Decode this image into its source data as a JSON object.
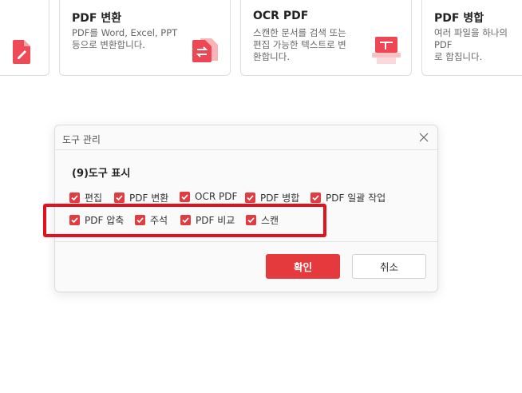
{
  "cards": [
    {
      "title": "",
      "desc_line1": "",
      "desc_line2": "",
      "icon": "edit-file-icon"
    },
    {
      "title": "PDF 변환",
      "desc_line1": "PDF를 Word, Excel, PPT",
      "desc_line2": "등으로 변환합니다.",
      "icon": "convert-file-icon"
    },
    {
      "title": "OCR PDF",
      "desc_line1": "스캔한 문서를 검색 또는",
      "desc_line2": "편집 가능한 텍스트로 변",
      "desc_line3": "환합니다.",
      "icon": "scanner-icon"
    },
    {
      "title": "PDF 병합",
      "desc_line1": "여러 파일을 하나의 PDF",
      "desc_line2": "로 합칩니다.",
      "icon": "merge-icon"
    }
  ],
  "dialog": {
    "title": "도구 관리",
    "section_title": "(9)도구 표시",
    "row1": [
      {
        "label": "편집",
        "checked": true
      },
      {
        "label": "PDF 변환",
        "checked": true
      },
      {
        "label": "OCR PDF",
        "checked": true
      },
      {
        "label": "PDF 병합",
        "checked": true
      },
      {
        "label": "PDF 일괄 작업",
        "checked": true
      }
    ],
    "row2": [
      {
        "label": "PDF 압축",
        "checked": true
      },
      {
        "label": "주석",
        "checked": true
      },
      {
        "label": "PDF 비교",
        "checked": true
      },
      {
        "label": "스캔",
        "checked": true
      }
    ],
    "ok_label": "확인",
    "cancel_label": "취소"
  },
  "colors": {
    "accent": "#e4393d",
    "highlight": "#e3101e"
  }
}
